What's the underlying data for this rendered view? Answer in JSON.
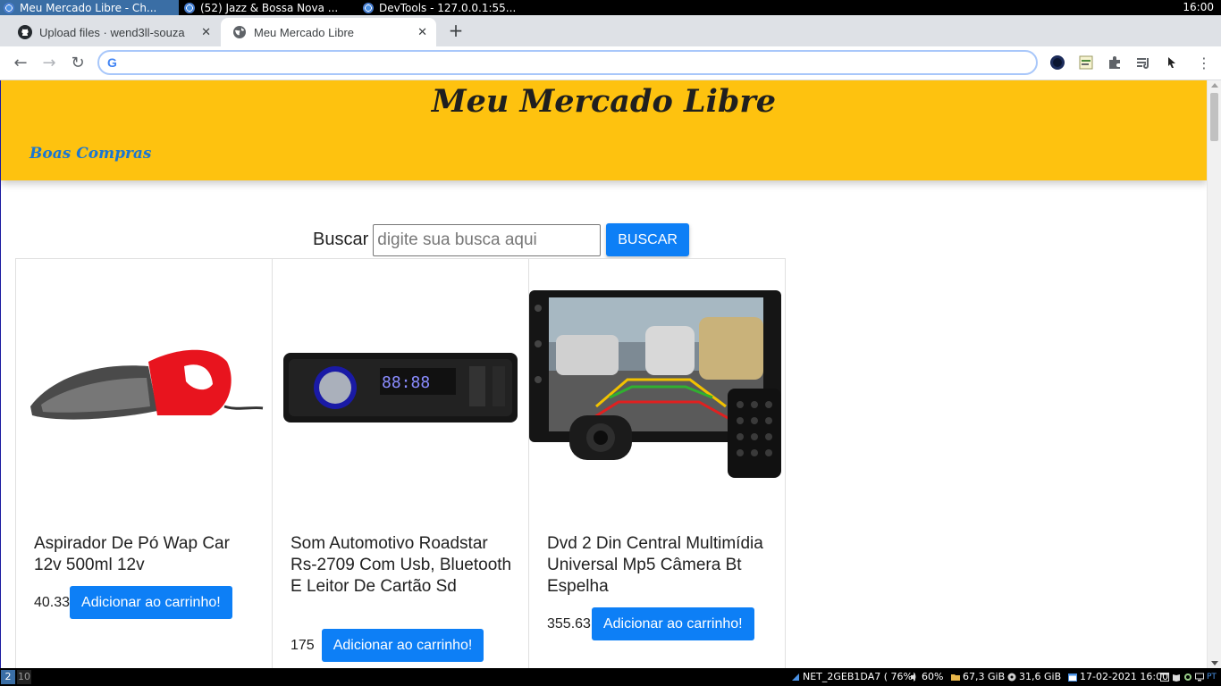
{
  "os_top": {
    "tasks": [
      {
        "label": "Meu Mercado Libre - Ch..."
      },
      {
        "label": "(52) Jazz & Bossa Nova ..."
      },
      {
        "label": "DevTools - 127.0.0.1:55..."
      }
    ],
    "clock": "16:00"
  },
  "browser": {
    "tabs": [
      {
        "title": "Upload files · wend3ll-souza",
        "icon": "github-icon"
      },
      {
        "title": "Meu Mercado Libre",
        "icon": "globe-icon"
      }
    ],
    "new_tab_label": "+",
    "omnibox_value": "",
    "google_icon_letter": "G"
  },
  "site": {
    "title": "Meu Mercado Libre",
    "header_link": "Boas Compras",
    "search": {
      "label": "Buscar",
      "placeholder": "digite sua busca aqui",
      "button": "BUSCAR"
    },
    "products": [
      {
        "title": "Aspirador De Pó Wap Car 12v 500ml 12v",
        "price": "40.33",
        "button": "Adicionar ao carrinho!",
        "image": "car-vacuum-image"
      },
      {
        "title": "Som Automotivo Roadstar Rs-2709 Com Usb, Bluetooth E Leitor De Cartão Sd",
        "price": "175",
        "button": "Adicionar ao carrinho!",
        "image": "car-stereo-image"
      },
      {
        "title": "Dvd 2 Din Central Multimídia Universal Mp5 Câmera Bt Espelha",
        "price": "355.63",
        "button": "Adicionar ao carrinho!",
        "image": "multimedia-center-image"
      }
    ]
  },
  "os_bottom": {
    "workspaces": [
      "2",
      "10"
    ],
    "network": "NET_2GEB1DA7 ( 76%)",
    "volume": "60%",
    "disk1": "67,3 GiB",
    "disk2": "31,6 GiB",
    "datetime": "17-02-2021 16:00",
    "lang": "PT"
  },
  "colors": {
    "header_bg": "#fec20f",
    "accent_blue": "#0d7ff6",
    "link_blue": "#1a76d2"
  }
}
